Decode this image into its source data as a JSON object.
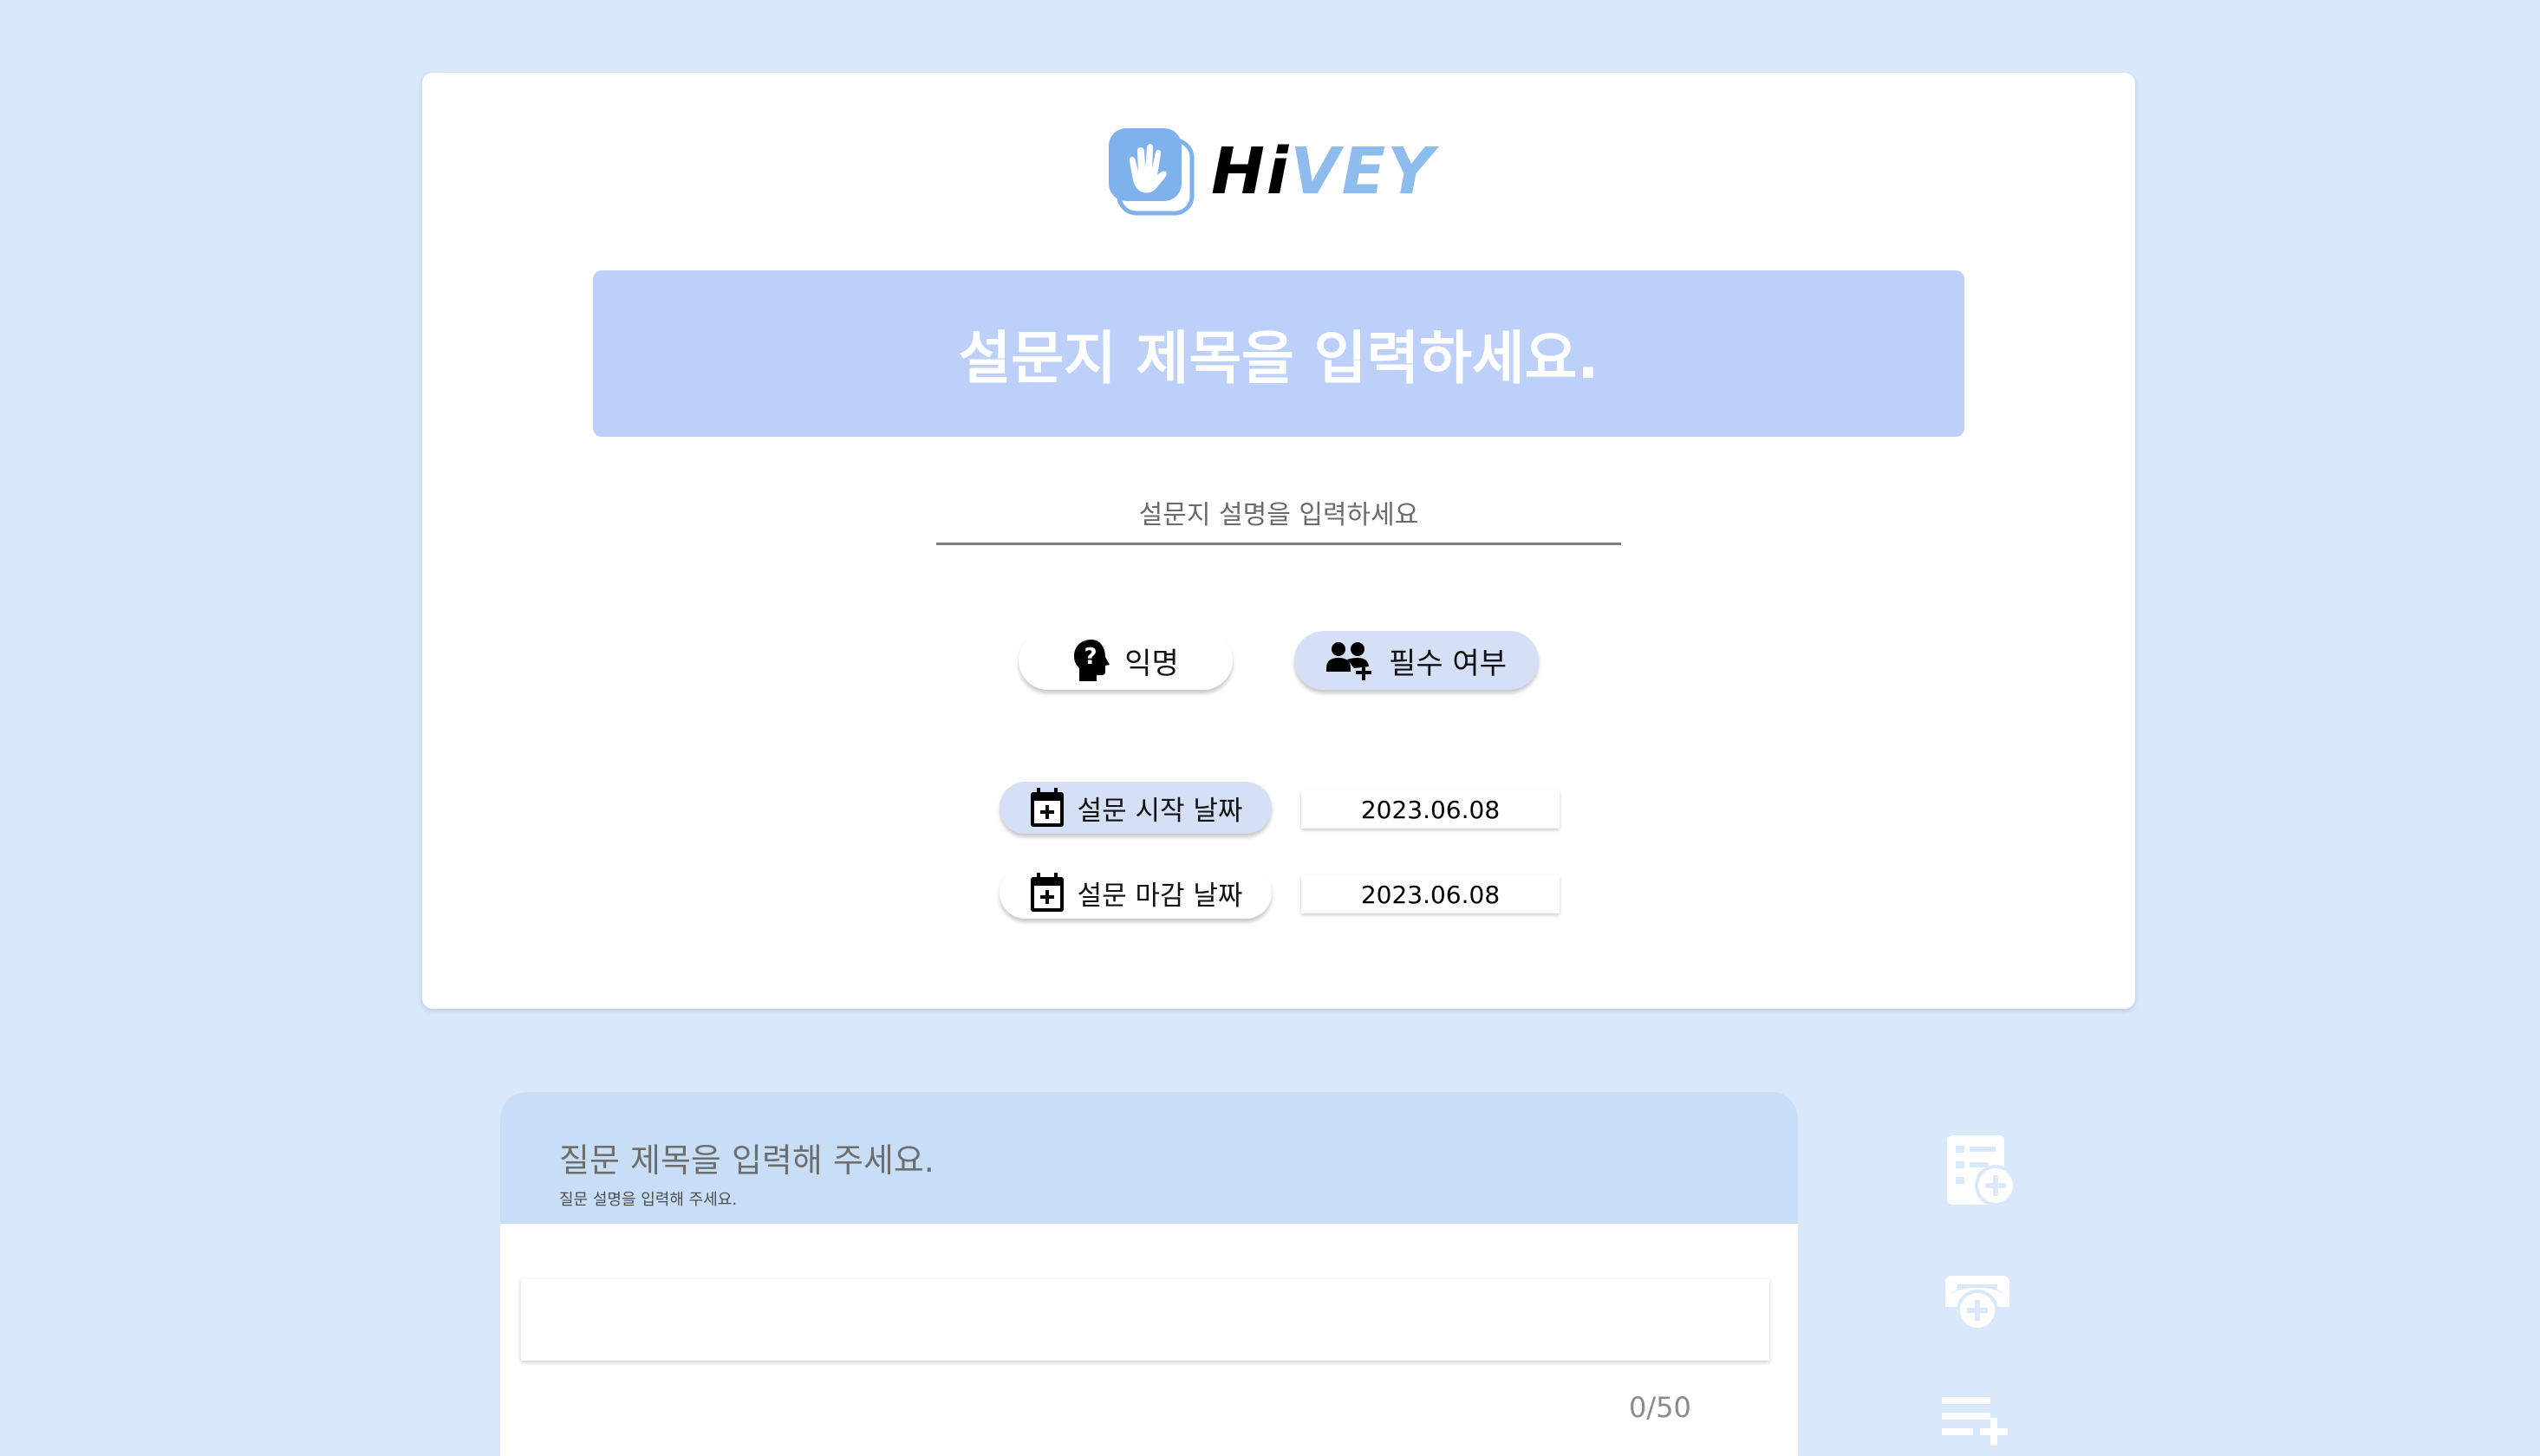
{
  "app": {
    "logo_hi": "Hi",
    "logo_vey": "VEY",
    "accent": "#8fbcef"
  },
  "survey": {
    "title_placeholder": "설문지 제목을 입력하세요.",
    "description_placeholder": "설문지 설명을 입력하세요"
  },
  "options": {
    "anonymous_label": "익명",
    "required_label": "필수 여부"
  },
  "dates": {
    "start_label": "설문 시작 날짜",
    "start_value": "2023.06.08",
    "end_label": "설문 마감 날짜",
    "end_value": "2023.06.08"
  },
  "question": {
    "title_placeholder": "질문 제목을 입력해 주세요.",
    "description_placeholder": "질문 설명을 입력해 주세요.",
    "char_count": "0/50"
  },
  "sidebar": {
    "icons": [
      "add-question-icon",
      "add-image-icon",
      "add-list-icon"
    ]
  },
  "colors": {
    "background": "#dae8fb",
    "title_bg": "#bdd0f9",
    "question_header": "#c8def7",
    "pill_active": "#d5e0f7"
  }
}
